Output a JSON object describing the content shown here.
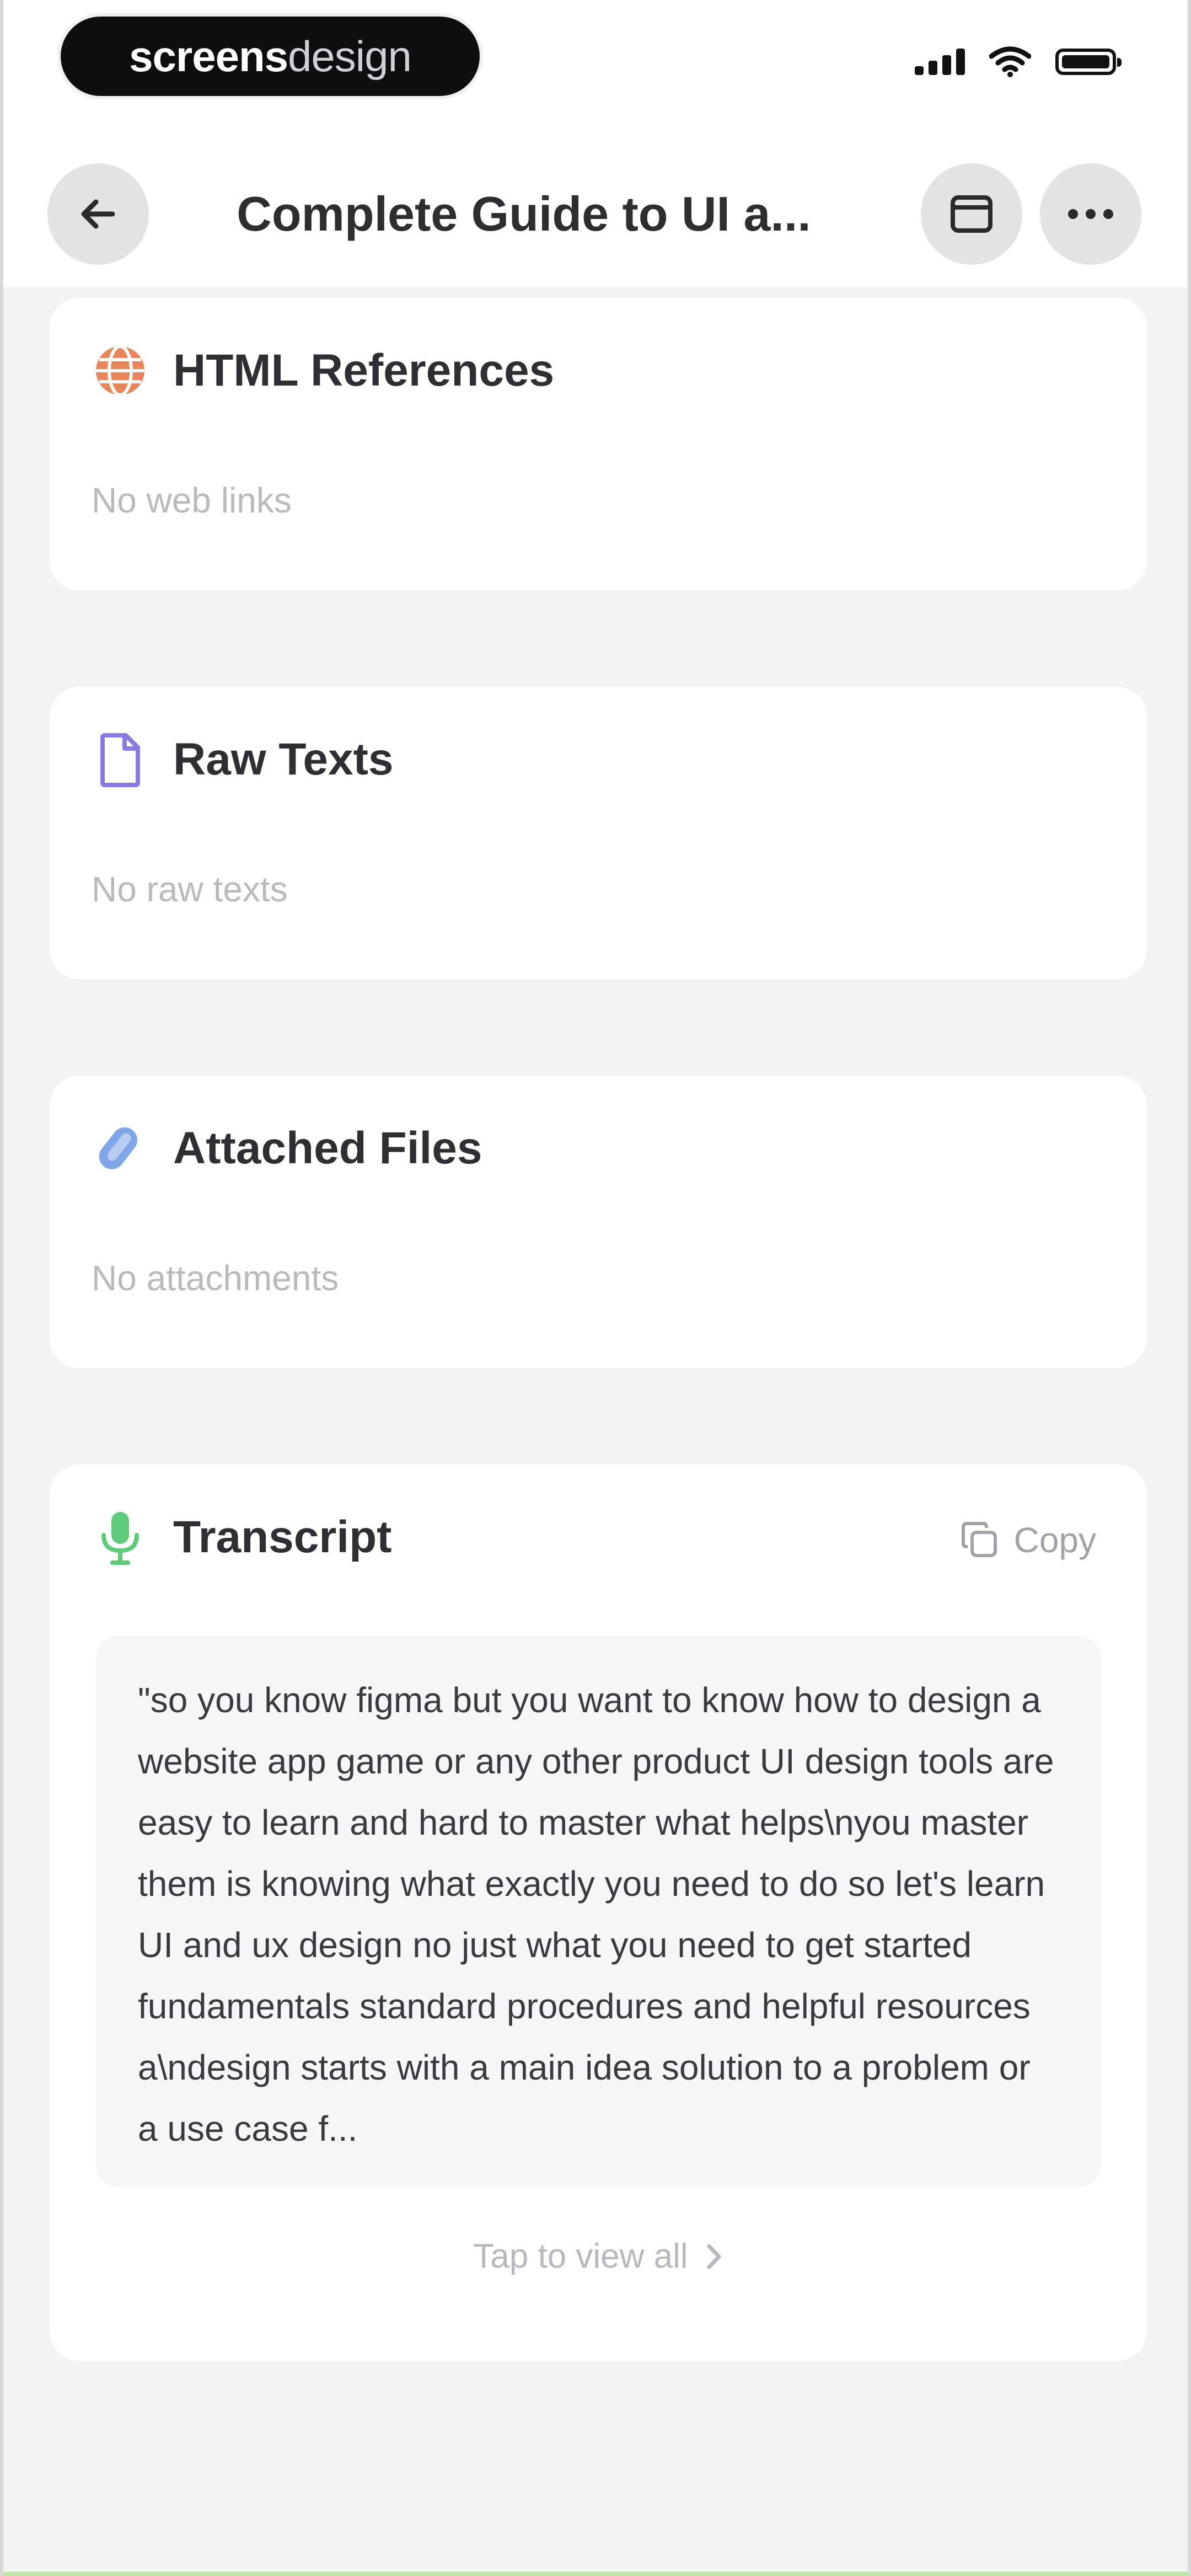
{
  "status_bar": {
    "brand_bold": "screens",
    "brand_light": "design"
  },
  "header": {
    "title": "Complete Guide to UI a..."
  },
  "sections": {
    "html_references": {
      "title": "HTML References",
      "empty_text": "No web links",
      "icon": "globe-icon",
      "icon_color": "#E8855A"
    },
    "raw_texts": {
      "title": "Raw Texts",
      "empty_text": "No raw texts",
      "icon": "document-icon",
      "icon_color": "#8B7BE0"
    },
    "attached_files": {
      "title": "Attached Files",
      "empty_text": "No attachments",
      "icon": "paperclip-icon",
      "icon_color": "#7FA6E6"
    },
    "transcript": {
      "title": "Transcript",
      "icon": "microphone-icon",
      "icon_color": "#5FCB7A",
      "copy_label": "Copy",
      "text": "\"so you know figma but you want to know how to design a website app game or any other product UI design tools are easy to learn and hard to master what helps\\nyou master them is knowing what exactly you need to do so let's learn UI and ux design no just what you need to get started fundamentals standard procedures and helpful resources a\\ndesign starts with a main idea solution to a problem or a use case f...",
      "view_all_label": "Tap to view all"
    }
  }
}
